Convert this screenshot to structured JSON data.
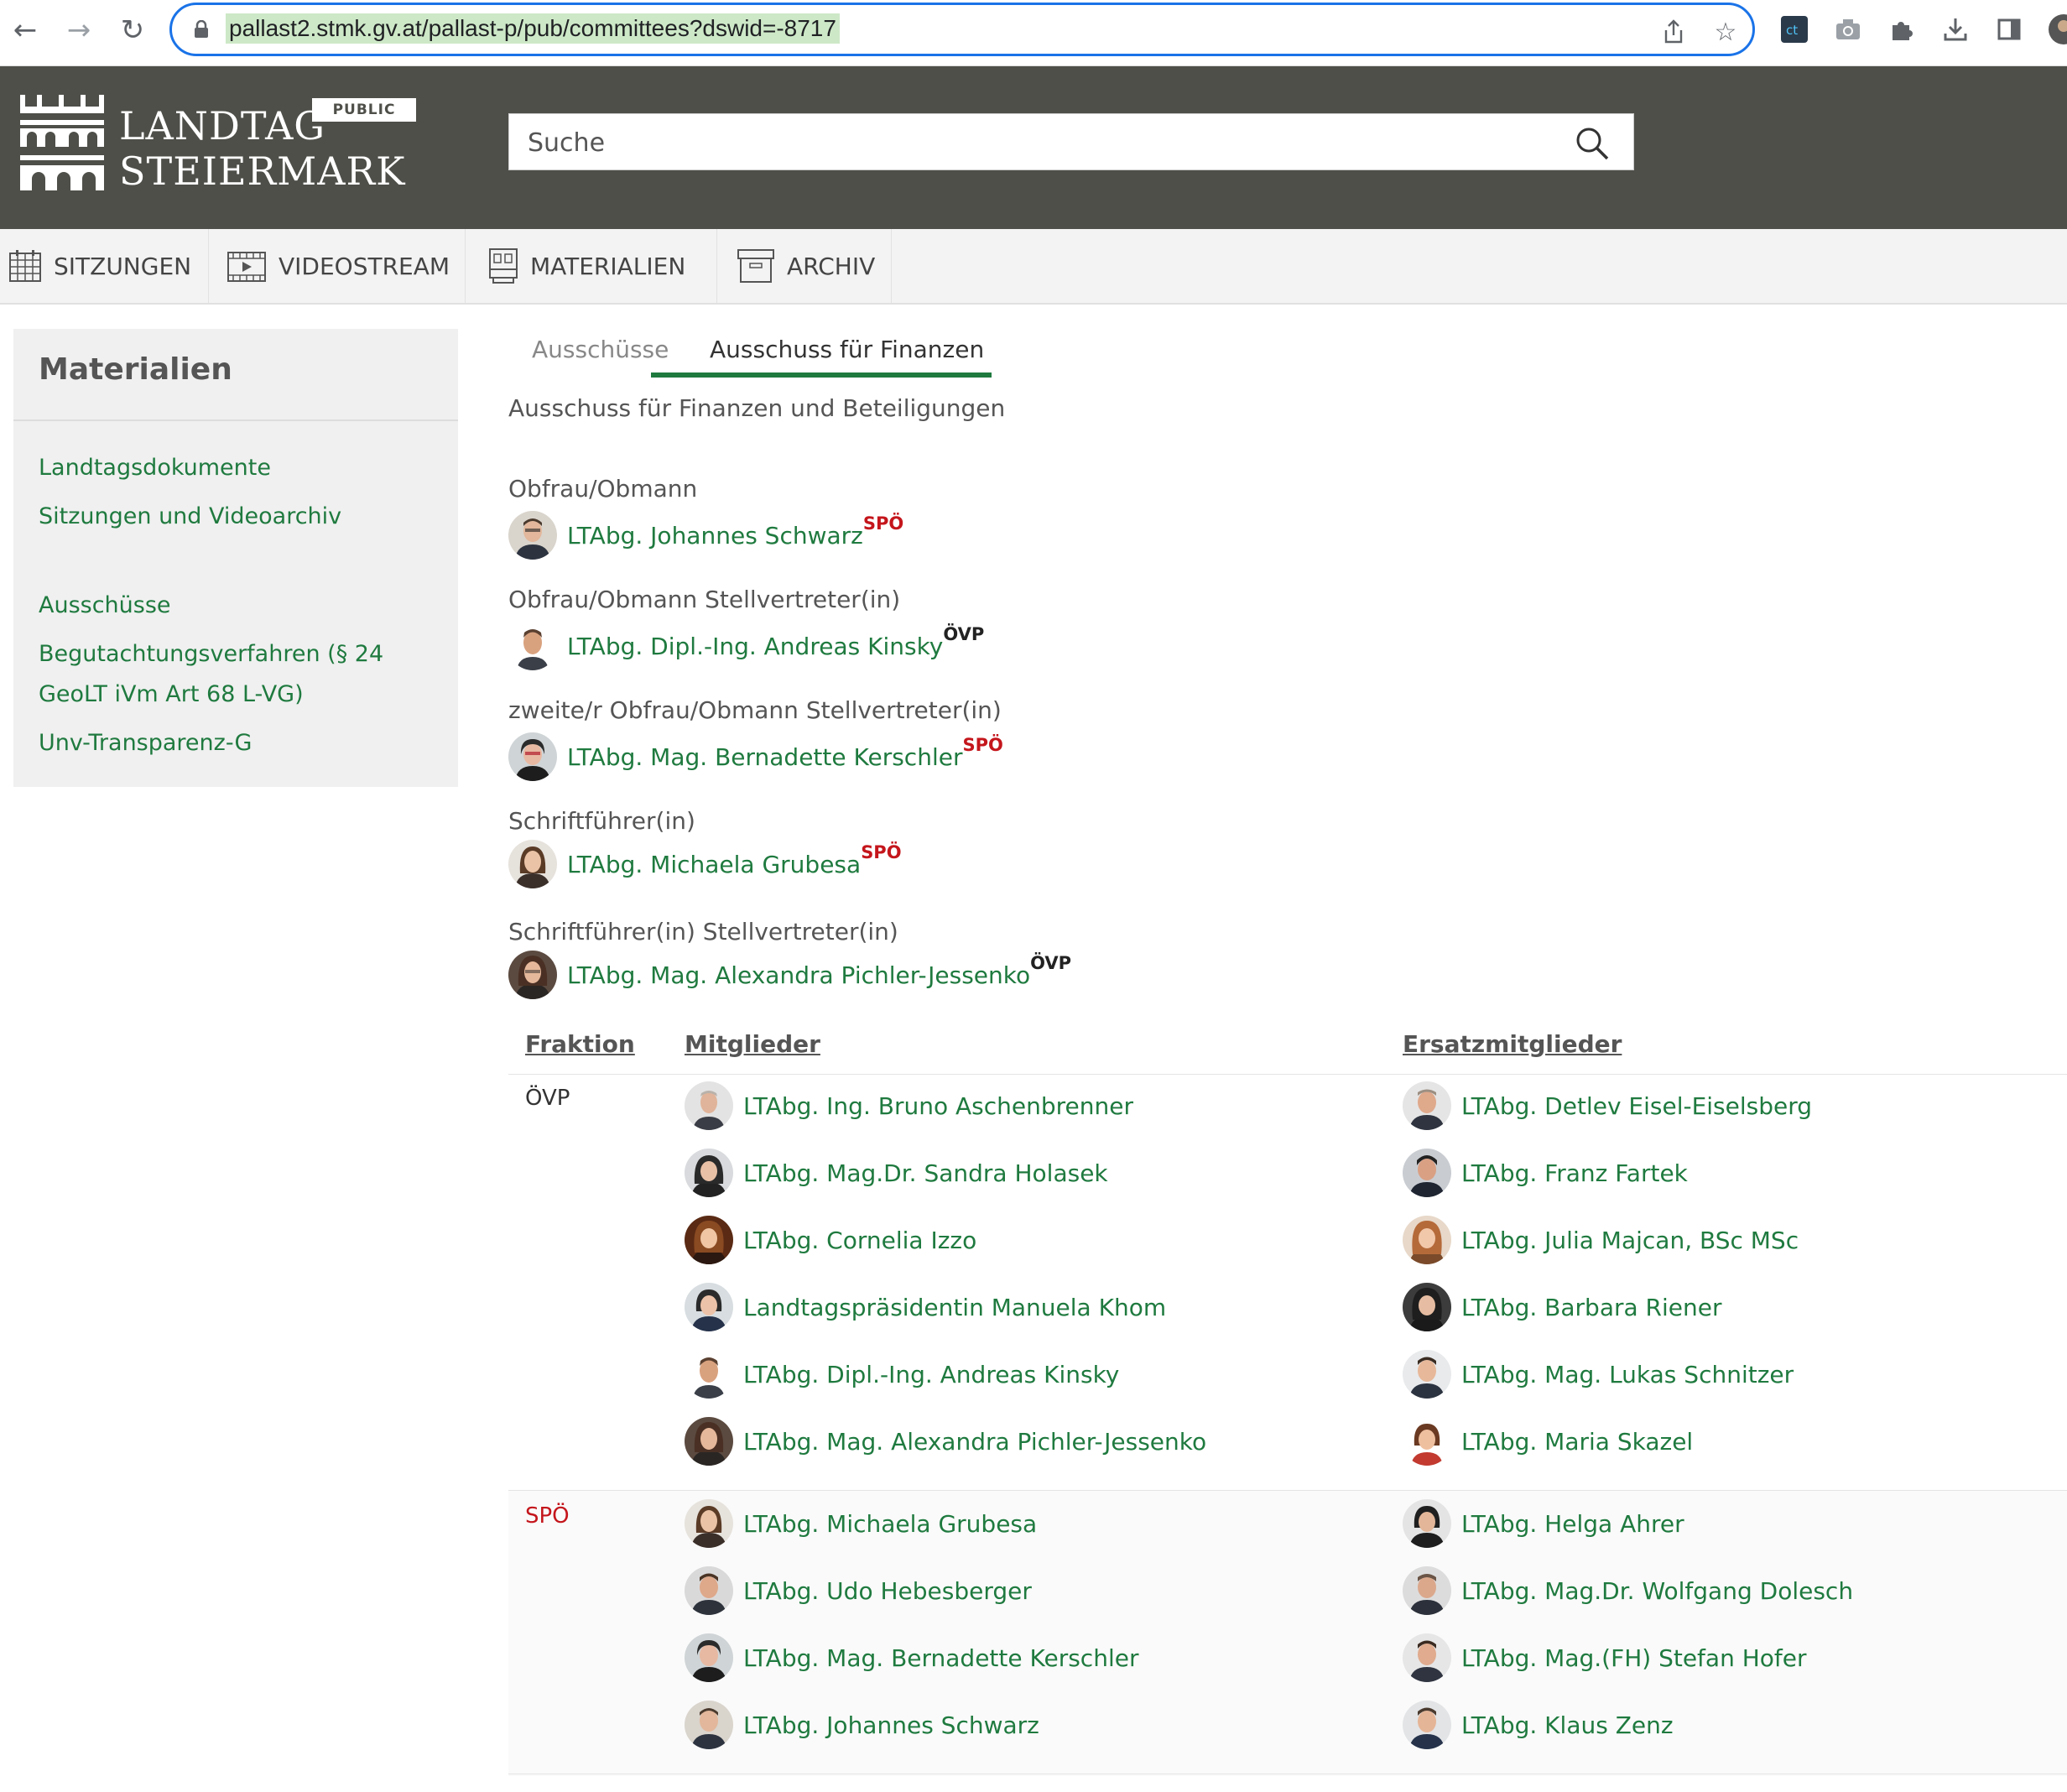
{
  "browser": {
    "url": "pallast2.stmk.gv.at/pallast-p/pub/committees?dswid=-8717"
  },
  "header": {
    "logo_line1": "LANDTAG",
    "logo_line2": "STEIERMARK",
    "badge": "PUBLIC",
    "search_placeholder": "Suche"
  },
  "menu": {
    "items": [
      "SITZUNGEN",
      "VIDEOSTREAM",
      "MATERIALIEN",
      "ARCHIV"
    ]
  },
  "sidebar": {
    "title": "Materialien",
    "links": [
      "Landtagsdokumente",
      "Sitzungen und Videoarchiv",
      "Ausschüsse",
      "Begutachtungsverfahren (§ 24",
      "GeoLT iVm Art 68 L-VG)",
      "Unv-Transparenz-G"
    ]
  },
  "tabs": [
    "Ausschüsse",
    "Ausschuss für Finanzen"
  ],
  "committee": {
    "full_name": "Ausschuss für Finanzen und Beteiligungen",
    "roles": [
      {
        "label": "Obfrau/Obmann",
        "name": "LTAbg. Johannes Schwarz",
        "party": "SPÖ"
      },
      {
        "label": "Obfrau/Obmann Stellvertreter(in)",
        "name": "LTAbg. Dipl.-Ing. Andreas Kinsky",
        "party": "ÖVP"
      },
      {
        "label": "zweite/r Obfrau/Obmann Stellvertreter(in)",
        "name": "LTAbg. Mag. Bernadette Kerschler",
        "party": "SPÖ"
      },
      {
        "label": "Schriftführer(in)",
        "name": "LTAbg. Michaela Grubesa",
        "party": "SPÖ"
      },
      {
        "label": "Schriftführer(in) Stellvertreter(in)",
        "name": "LTAbg. Mag. Alexandra Pichler-Jessenko",
        "party": "ÖVP"
      }
    ]
  },
  "table": {
    "headers": [
      "Fraktion",
      "Mitglieder",
      "Ersatzmitglieder"
    ],
    "groups": [
      {
        "fraktion": "ÖVP",
        "members": [
          "LTAbg. Ing. Bruno Aschenbrenner",
          "LTAbg. Mag.Dr. Sandra Holasek",
          "LTAbg. Cornelia Izzo",
          "Landtagspräsidentin Manuela Khom",
          "LTAbg. Dipl.-Ing. Andreas Kinsky",
          "LTAbg. Mag. Alexandra Pichler-Jessenko"
        ],
        "substitutes": [
          "LTAbg. Detlev Eisel-Eiselsberg",
          "LTAbg. Franz Fartek",
          "LTAbg. Julia Majcan, BSc MSc",
          "LTAbg. Barbara Riener",
          "LTAbg. Mag. Lukas Schnitzer",
          "LTAbg. Maria Skazel"
        ]
      },
      {
        "fraktion": "SPÖ",
        "members": [
          "LTAbg. Michaela Grubesa",
          "LTAbg. Udo Hebesberger",
          "LTAbg. Mag. Bernadette Kerschler",
          "LTAbg. Johannes Schwarz"
        ],
        "substitutes": [
          "LTAbg. Helga Ahrer",
          "LTAbg. Mag.Dr. Wolfgang Dolesch",
          "LTAbg. Mag.(FH) Stefan Hofer",
          "LTAbg. Klaus Zenz"
        ]
      }
    ]
  },
  "colors": {
    "header_bg": "#4f4f4a",
    "link_green": "#1f7a3f",
    "spo_red": "#c4161c"
  }
}
